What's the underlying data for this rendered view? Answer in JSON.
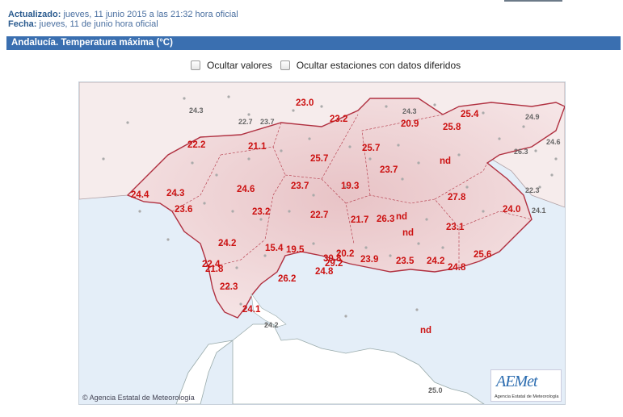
{
  "meta": {
    "updated_label": "Actualizado:",
    "updated_value": "jueves, 11 junio 2015 a las 21:32 hora oficial",
    "date_label": "Fecha:",
    "date_value": "jueves, 11 de junio hora oficial"
  },
  "title": "Andalucía. Temperatura máxima (°C)",
  "controls": {
    "hide_values": "Ocultar valores",
    "hide_deferred": "Ocultar estaciones con datos diferidos"
  },
  "credit": "Agencia Estatal de Meteorología",
  "logo": {
    "mark": "AEMet",
    "sub": "Agencia Estatal de Meteorología"
  },
  "colors": {
    "andalucia_value": "#cc1111",
    "neighbor_value": "#666666",
    "sea": "#e4eef8",
    "land": "#f3d9da",
    "border": "#b03040",
    "title_bar": "#3a6fb0"
  },
  "values_andalucia": [
    "23.0",
    "23.2",
    "20.9",
    "25.4",
    "25.8",
    "22.2",
    "21.1",
    "25.7",
    "25.7",
    "nd",
    "24.4",
    "24.3",
    "24.6",
    "23.7",
    "19.3",
    "23.7",
    "27.8",
    "23.6",
    "23.2",
    "22.7",
    "21.7",
    "26.3",
    "nd",
    "24.0",
    "nd",
    "23.1",
    "24.2",
    "15.4",
    "19.5",
    "20.2",
    "30.8",
    "29.2",
    "23.9",
    "23.5",
    "24.2",
    "25.6",
    "24.8",
    "22.4",
    "21.8",
    "26.2",
    "24.8",
    "22.3",
    "24.1",
    "nd"
  ],
  "values_other": [
    "24.3",
    "22.7",
    "23.7",
    "24.3",
    "24.9",
    "26.3",
    "24.6",
    "22.3",
    "24.1",
    "24.2",
    "25.0"
  ]
}
